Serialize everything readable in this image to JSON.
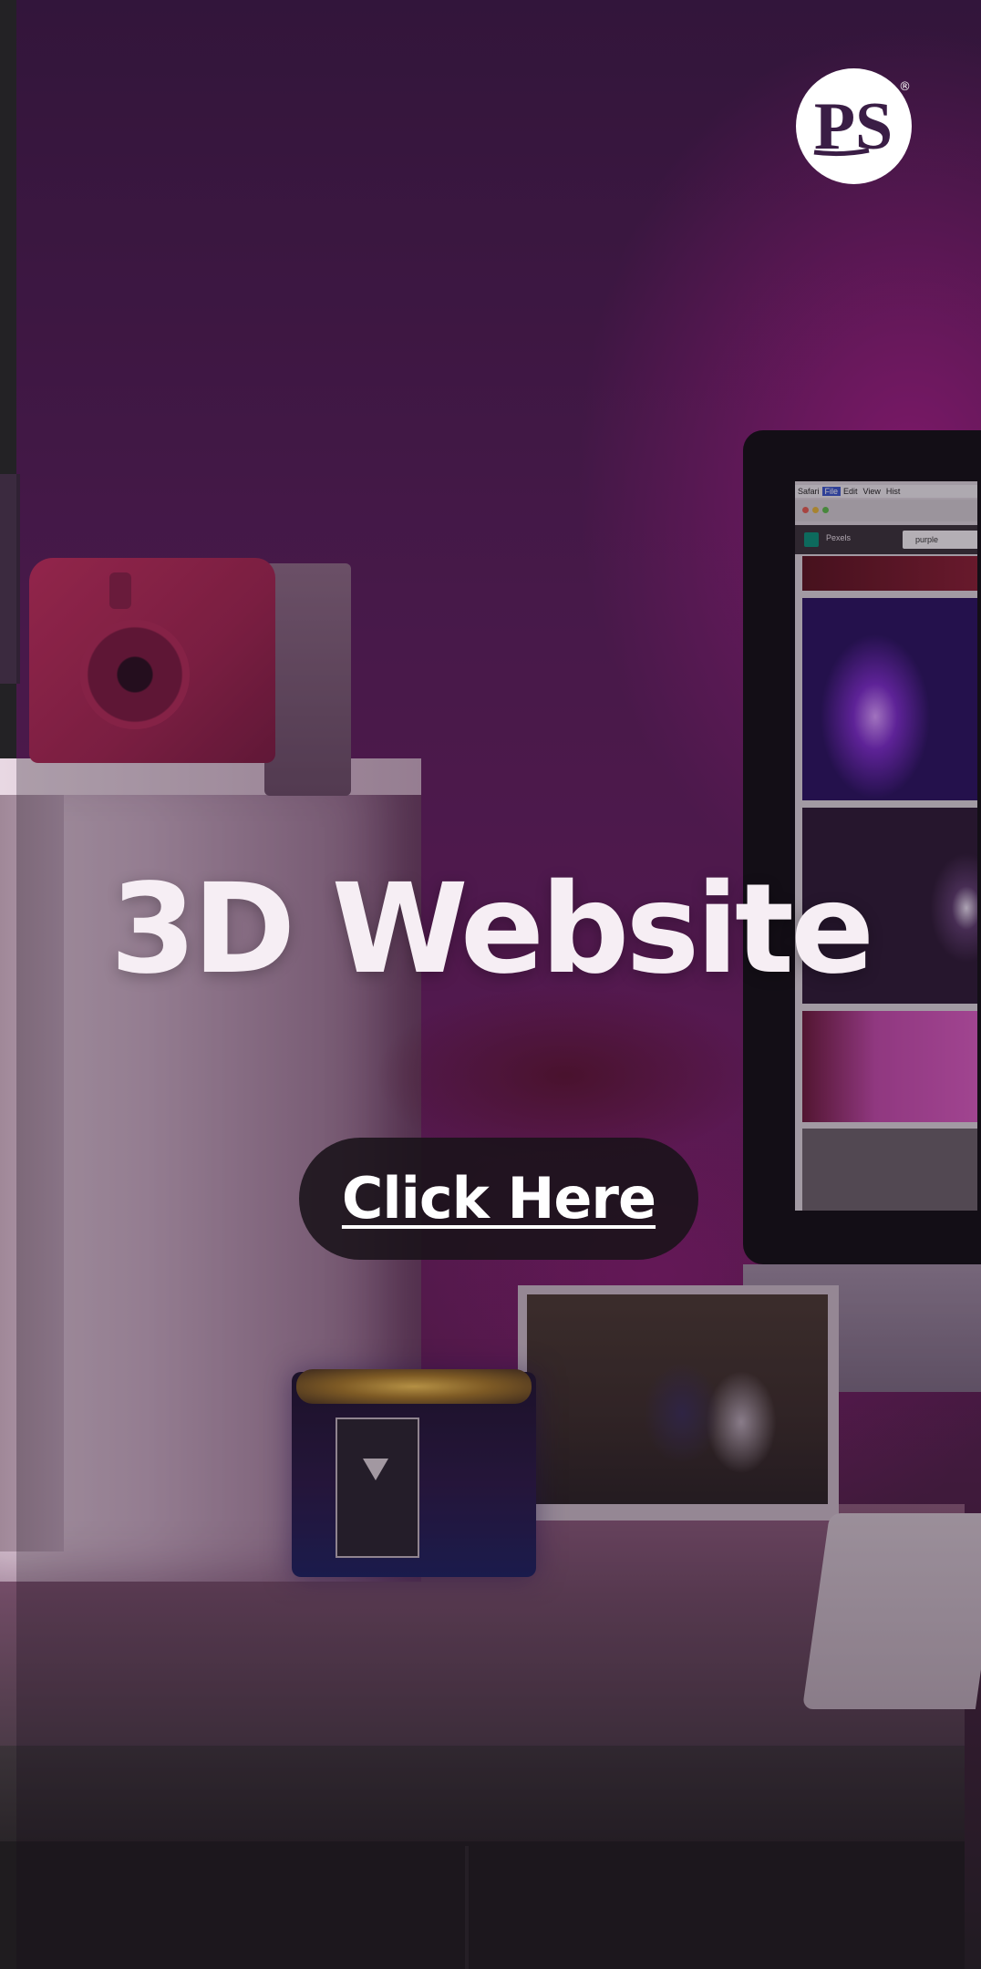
{
  "brand": {
    "logo_text": "PS",
    "registered_mark": "®",
    "logo_color": "#ffffff"
  },
  "hero": {
    "title": "3D Website",
    "cta_label": "Click Here"
  },
  "background": {
    "icon": "desk-setup-photo",
    "screen": {
      "menu": [
        "Safari",
        "File",
        "Edit",
        "View",
        "Hist"
      ],
      "site_name": "Pexels",
      "search_value": "purple"
    }
  },
  "colors": {
    "accent": "#7a1f6a",
    "text": "#f6eef4",
    "button_bg": "#191219"
  }
}
